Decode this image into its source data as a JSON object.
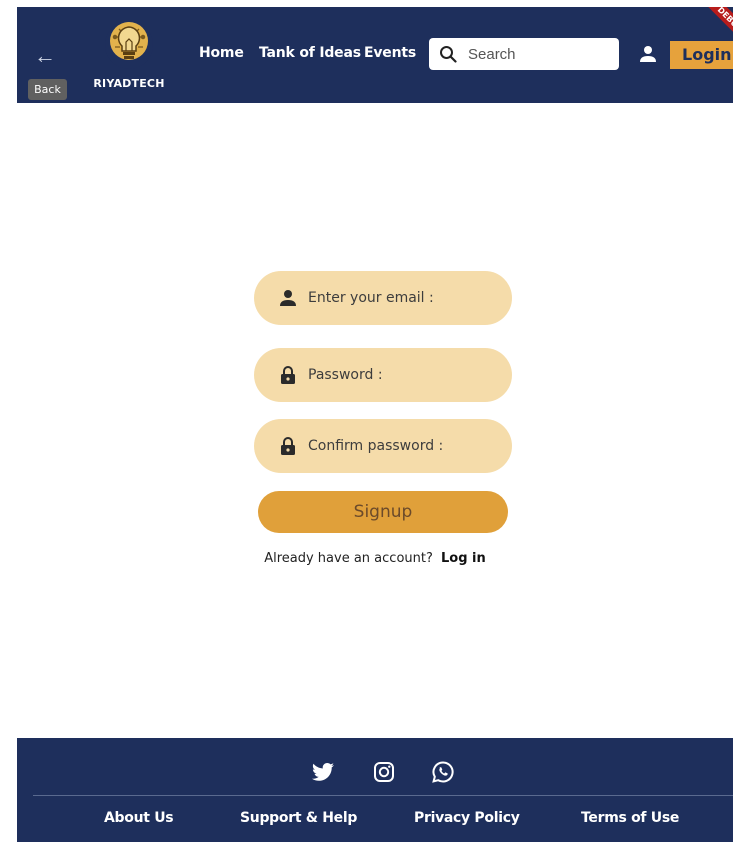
{
  "header": {
    "back_tooltip": "Back",
    "logo_text": "RIYADTECH",
    "nav": {
      "home": "Home",
      "tank_of_ideas": "Tank of Ideas",
      "events": "Events"
    },
    "search": {
      "placeholder": "Search",
      "value": ""
    },
    "login_button": "Login",
    "debug_banner": "DEBUG"
  },
  "form": {
    "email": {
      "placeholder": "Enter your email :",
      "icon": "person-icon"
    },
    "password": {
      "placeholder": "Password :",
      "icon": "lock-icon"
    },
    "confirm_password": {
      "placeholder": "Confirm password :",
      "icon": "lock-icon"
    },
    "signup_button": "Signup",
    "account_prompt": "Already have an account?",
    "login_link": "Log in"
  },
  "footer": {
    "social": [
      "twitter-icon",
      "instagram-icon",
      "whatsapp-icon"
    ],
    "links": {
      "about": "About Us",
      "support": "Support & Help",
      "privacy": "Privacy Policy",
      "terms": "Terms of Use"
    }
  },
  "colors": {
    "header_bg": "#1e2f5c",
    "accent": "#e6a23c",
    "field_bg": "#f5dcaa",
    "signup_bg": "#e0a03a"
  }
}
